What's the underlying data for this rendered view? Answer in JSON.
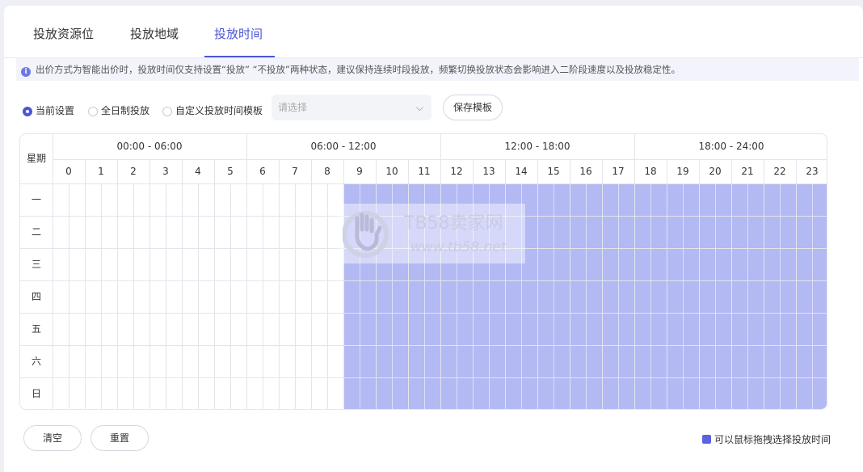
{
  "tabs": [
    {
      "label": "投放资源位",
      "active": false
    },
    {
      "label": "投放地域",
      "active": false
    },
    {
      "label": "投放时间",
      "active": true
    }
  ],
  "notice": {
    "icon": "info-icon",
    "text": "出价方式为智能出价时，投放时间仅支持设置“投放” “不投放”两种状态，建议保持连续时段投放，频繁切换投放状态会影响进入二阶段速度以及投放稳定性。"
  },
  "radios": [
    {
      "label": "当前设置",
      "checked": true
    },
    {
      "label": "全日制投放",
      "checked": false
    },
    {
      "label": "自定义投放时间模板",
      "checked": false
    }
  ],
  "template_select": {
    "placeholder": "请选择"
  },
  "save_template_label": "保存模板",
  "schedule": {
    "weekday_header": "星期",
    "ranges": [
      "00:00 - 06:00",
      "06:00 - 12:00",
      "12:00 - 18:00",
      "18:00 - 24:00"
    ],
    "hours": [
      "0",
      "1",
      "2",
      "3",
      "4",
      "5",
      "6",
      "7",
      "8",
      "9",
      "10",
      "11",
      "12",
      "13",
      "14",
      "15",
      "16",
      "17",
      "18",
      "19",
      "20",
      "21",
      "22",
      "23"
    ],
    "days": [
      "一",
      "二",
      "三",
      "四",
      "五",
      "六",
      "日"
    ],
    "selected_from_hour": 9,
    "selected_to_hour": 23,
    "selected_color": "#b3b9f3"
  },
  "watermark": {
    "title": "TB58卖家网",
    "url": "www.tb58.net"
  },
  "clear_label": "清空",
  "reset_label": "重置",
  "hint_text": "可以鼠标拖拽选择投放时间",
  "accent": "#4a55d8"
}
